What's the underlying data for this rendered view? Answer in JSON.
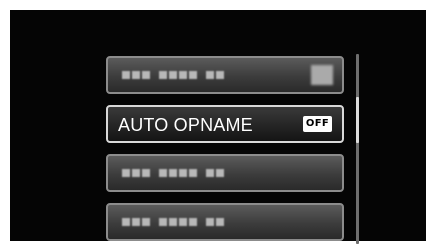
{
  "menu": {
    "items": [
      {
        "label": "",
        "badge": "",
        "selected": false
      },
      {
        "label": "AUTO OPNAME",
        "badge": "OFF",
        "selected": true
      },
      {
        "label": "",
        "badge": "",
        "selected": false
      },
      {
        "label": "",
        "badge": "",
        "selected": false
      }
    ]
  },
  "scrollbar": {
    "position_fraction": 0.3
  },
  "colors": {
    "screen_background": "#050505",
    "item_border": "#8c8c8c",
    "selected_border": "#d8d8d8",
    "badge_background": "#ffffff"
  }
}
